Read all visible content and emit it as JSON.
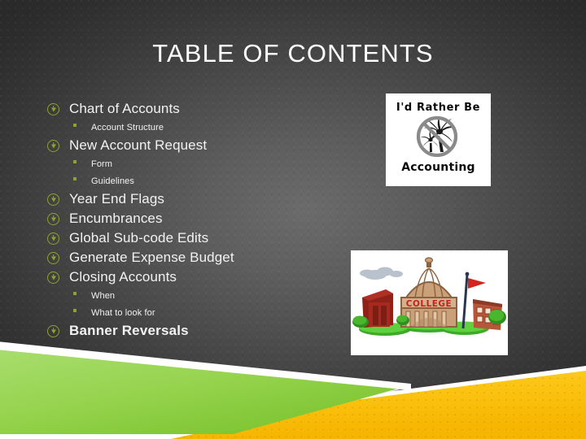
{
  "slide": {
    "title": "TABLE OF CONTENTS",
    "background_color": "#4a4a4a",
    "accent_green": "#8ea22e",
    "band_green": "#8fd14a",
    "band_yellow": "#fcc20a",
    "text_color": "#f2f2f2"
  },
  "outline": [
    {
      "level": 1,
      "text": "Chart of Accounts",
      "bullet": "circled-arrow-bullet",
      "bold": false
    },
    {
      "level": 2,
      "text": "Account Structure",
      "bullet": "square-bullet",
      "bold": false
    },
    {
      "level": 1,
      "text": "New Account Request",
      "bullet": "circled-arrow-bullet",
      "bold": false
    },
    {
      "level": 2,
      "text": "Form",
      "bullet": "square-bullet",
      "bold": false
    },
    {
      "level": 2,
      "text": "Guidelines",
      "bullet": "square-bullet",
      "bold": false
    },
    {
      "level": 1,
      "text": "Year End Flags",
      "bullet": "circled-arrow-bullet",
      "bold": false
    },
    {
      "level": 1,
      "text": "Encumbrances",
      "bullet": "circled-arrow-bullet",
      "bold": false
    },
    {
      "level": 1,
      "text": "Global Sub-code Edits",
      "bullet": "circled-arrow-bullet",
      "bold": false
    },
    {
      "level": 1,
      "text": "Generate Expense Budget",
      "bullet": "circled-arrow-bullet",
      "bold": false
    },
    {
      "level": 1,
      "text": "Closing Accounts",
      "bullet": "circled-arrow-bullet",
      "bold": false
    },
    {
      "level": 2,
      "text": "When",
      "bullet": "square-bullet",
      "bold": false
    },
    {
      "level": 2,
      "text": "What to look for",
      "bullet": "square-bullet",
      "bold": false
    },
    {
      "level": 1,
      "text": "Banner Reversals",
      "bullet": "circled-arrow-bullet",
      "bold": true
    }
  ],
  "clipart_accounting": {
    "name": "id-rather-be-accounting-clipart",
    "line1": "I'd  Rather  Be",
    "line2": "Accounting",
    "symbol": "no-palm-tree-prohibition-sign"
  },
  "clipart_college": {
    "name": "college-campus-clipart",
    "sign_text": "COLLEGE"
  }
}
